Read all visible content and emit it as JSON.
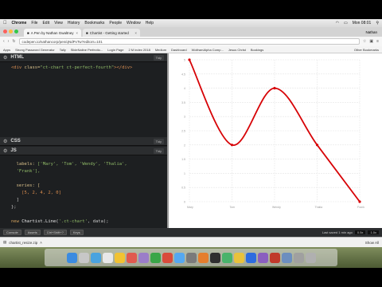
{
  "menubar": {
    "apple": "",
    "items": [
      "Chrome",
      "File",
      "Edit",
      "View",
      "History",
      "Bookmarks",
      "People",
      "Window",
      "Help"
    ],
    "clock": "Mon 08:01",
    "user": "Nathan"
  },
  "tabs": [
    {
      "title": "A Pen by Nathan Gwaltney",
      "active": true
    },
    {
      "title": "Chartist - Getting started",
      "active": false
    }
  ],
  "address": {
    "url": "codepen.io/nathancorp/pen/qNdPxTw?editors=101"
  },
  "bookmarks": {
    "items": [
      "Apps",
      "Strong Password Generator",
      "Tally",
      "SlideNaline Perfectio...",
      "Login Page",
      "2 M index 2018",
      "Medium",
      "Dashboard",
      "WolframAlpha Comp...",
      "Jesus Christ",
      "Bookings"
    ],
    "other": "Other Bookmarks"
  },
  "html_pane": {
    "title": "HTML",
    "tidy": "Tidy",
    "code_indent": "  ",
    "tag_open": "<div",
    "attr_name": " class=",
    "attr_value": "\"ct-chart ct-perfect-fourth\"",
    "tag_close": "></div>"
  },
  "css_pane": {
    "title": "CSS",
    "tidy": "Tidy"
  },
  "js_pane": {
    "title": "JS",
    "tidy": "Tidy",
    "labels_key": "labels: ",
    "labels_line1": "['Mary', 'Tom', 'Wendy', 'Thalia',",
    "labels_line2": "'Frank'],",
    "series_key": "series: [",
    "series_values": "[5, 2, 4, 2, 0]",
    "series_close": "]",
    "object_close": "};",
    "call_kw": "new ",
    "call_fn": "Chartist.Line(",
    "call_arg": "'.ct-chart'",
    "call_end": ", data);"
  },
  "console_bar": {
    "console": "Console",
    "assets": "Assets",
    "cmd1": "Ctrl+Shift+?",
    "cmd2": "Keys",
    "zoom": "0.5x",
    "zoom2": "1.0x",
    "last_saved": "Last saved 1 min ago"
  },
  "downloads": {
    "file": "chartist_resize.zip",
    "show_all": "Show All"
  },
  "chart_data": {
    "type": "line",
    "categories": [
      "Mary",
      "Tom",
      "Wendy",
      "Thalia",
      "Frank"
    ],
    "series": [
      {
        "values": [
          5,
          2,
          4,
          2,
          0
        ]
      }
    ],
    "ylim": [
      0,
      5
    ],
    "y_ticks": [
      "5",
      "4.5",
      "4",
      "3.5",
      "3",
      "2.5",
      "2",
      "1.5",
      "1",
      "0.5",
      "0"
    ],
    "grid": true,
    "line_color": "#d70206",
    "smooth": true
  },
  "colors": {
    "editor_bg": "#1d1f21",
    "accent_red": "#d70206"
  }
}
